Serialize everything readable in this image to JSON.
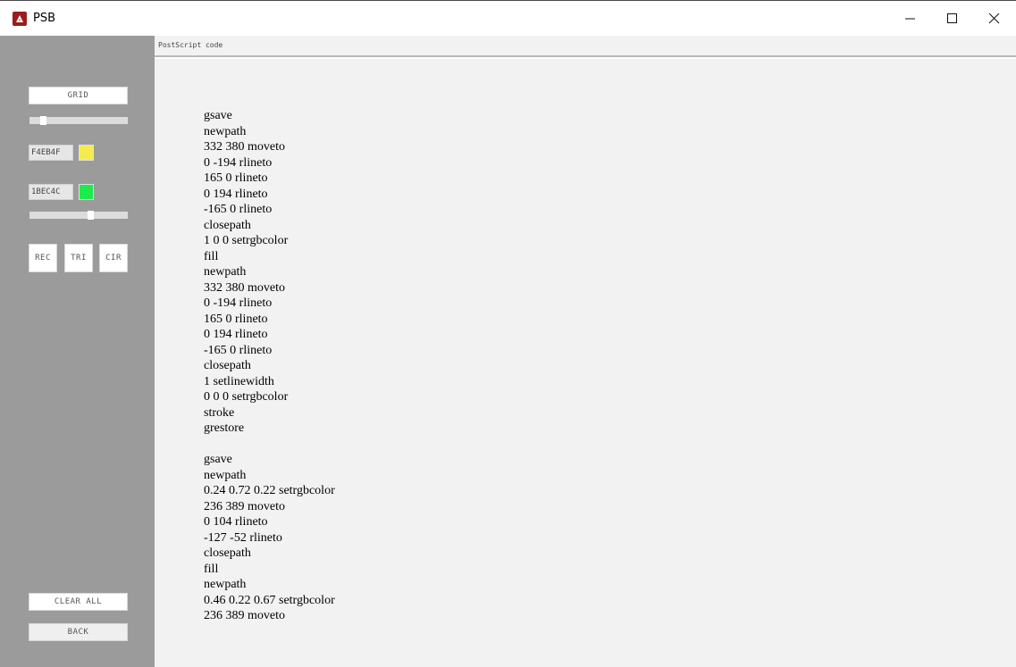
{
  "window": {
    "title": "PSB",
    "minimize_icon": "minimize-icon",
    "maximize_icon": "maximize-icon",
    "close_icon": "close-icon"
  },
  "sidebar": {
    "grid_label": "GRID",
    "grid_slider_level": 0.12,
    "fill_hex": "F4EB4F",
    "fill_color": "#F4EB4F",
    "stroke_hex": "1BEC4C",
    "stroke_color": "#1BEC4C",
    "color_slider_level": 0.63,
    "shape_buttons": {
      "rec": "REC",
      "tri": "TRI",
      "cir": "CIR"
    },
    "clear_all_label": "CLEAR ALL",
    "back_label": "BACK"
  },
  "code_pane": {
    "header": "PostScript code",
    "lines": [
      "gsave",
      "newpath",
      "332 380 moveto",
      "0 -194 rlineto",
      "165 0 rlineto",
      "0 194 rlineto",
      "-165 0 rlineto",
      "closepath",
      "1 0 0 setrgbcolor",
      "fill",
      "newpath",
      "332 380 moveto",
      "0 -194 rlineto",
      "165 0 rlineto",
      "0 194 rlineto",
      "-165 0 rlineto",
      "closepath",
      "1 setlinewidth",
      "0 0 0 setrgbcolor",
      "stroke",
      "grestore",
      "",
      "gsave",
      "newpath",
      "0.24 0.72 0.22 setrgbcolor",
      "236 389 moveto",
      "0 104 rlineto",
      "-127 -52 rlineto",
      "closepath",
      "fill",
      "newpath",
      "0.46 0.22 0.67 setrgbcolor",
      "236 389 moveto"
    ]
  }
}
